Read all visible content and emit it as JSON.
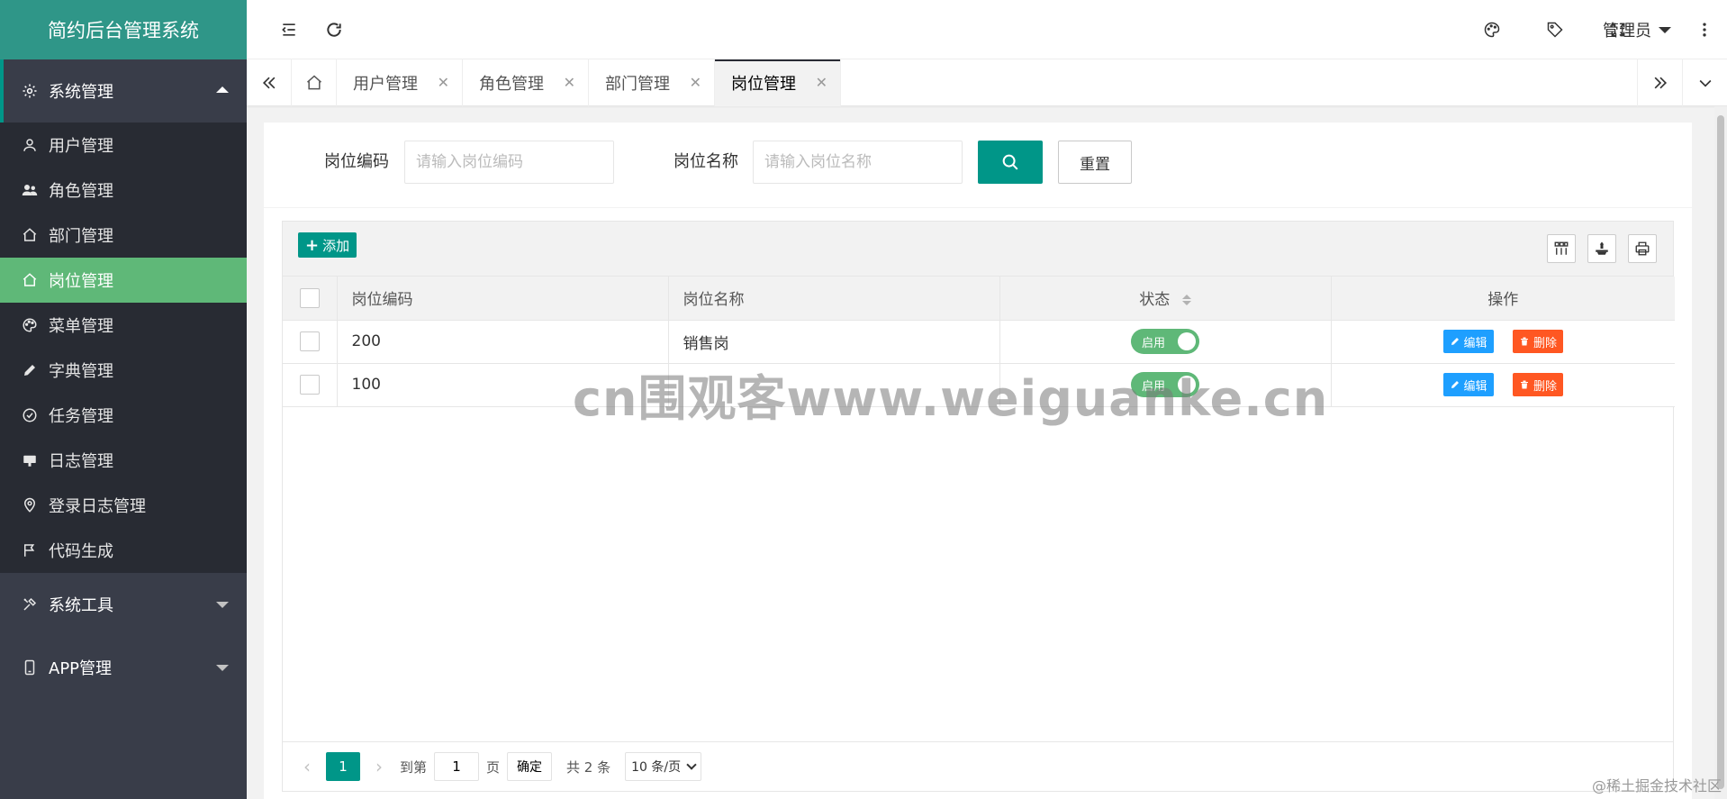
{
  "app_title": "简约后台管理系统",
  "sidebar": {
    "groups": [
      {
        "label": "系统管理",
        "icon": "gear-icon",
        "expanded": true
      },
      {
        "label": "系统工具",
        "icon": "tools-icon",
        "expanded": false
      },
      {
        "label": "APP管理",
        "icon": "mobile-icon",
        "expanded": false
      }
    ],
    "items": [
      {
        "label": "用户管理",
        "icon": "user-icon"
      },
      {
        "label": "角色管理",
        "icon": "users-icon"
      },
      {
        "label": "部门管理",
        "icon": "home-icon"
      },
      {
        "label": "岗位管理",
        "icon": "home-icon",
        "active": true
      },
      {
        "label": "菜单管理",
        "icon": "palette-icon"
      },
      {
        "label": "字典管理",
        "icon": "pencil-icon"
      },
      {
        "label": "任务管理",
        "icon": "check-circle-icon"
      },
      {
        "label": "日志管理",
        "icon": "board-icon"
      },
      {
        "label": "登录日志管理",
        "icon": "location-icon"
      },
      {
        "label": "代码生成",
        "icon": "flag-icon"
      }
    ]
  },
  "header": {
    "admin_label": "管理员"
  },
  "tabs": [
    {
      "label": "用户管理"
    },
    {
      "label": "角色管理"
    },
    {
      "label": "部门管理"
    },
    {
      "label": "岗位管理",
      "active": true
    }
  ],
  "search": {
    "code_label": "岗位编码",
    "code_placeholder": "请输入岗位编码",
    "name_label": "岗位名称",
    "name_placeholder": "请输入岗位名称",
    "reset_label": "重置"
  },
  "toolbar": {
    "add_label": "添加"
  },
  "table": {
    "columns": [
      "岗位编码",
      "岗位名称",
      "状态",
      "操作"
    ],
    "rows": [
      {
        "code": "200",
        "name": "销售岗",
        "status": "启用"
      },
      {
        "code": "100",
        "name": "",
        "status": "启用"
      }
    ],
    "edit_label": "编辑",
    "delete_label": "删除"
  },
  "pager": {
    "current_page": "1",
    "goto_label": "到第",
    "goto_value": "1",
    "page_unit": "页",
    "confirm_label": "确定",
    "total_label": "共 2 条",
    "page_size_label": "10 条/页"
  },
  "watermark": "cn围观客www.weiguanke.cn",
  "credit": "@稀土掘金技术社区",
  "colors": {
    "brand": "#009688",
    "sidebar_bg": "#393d49",
    "sidebar_sub_bg": "#282b33",
    "active_item": "#5fb878",
    "edit_btn": "#1e9fff",
    "delete_btn": "#ff5722"
  }
}
